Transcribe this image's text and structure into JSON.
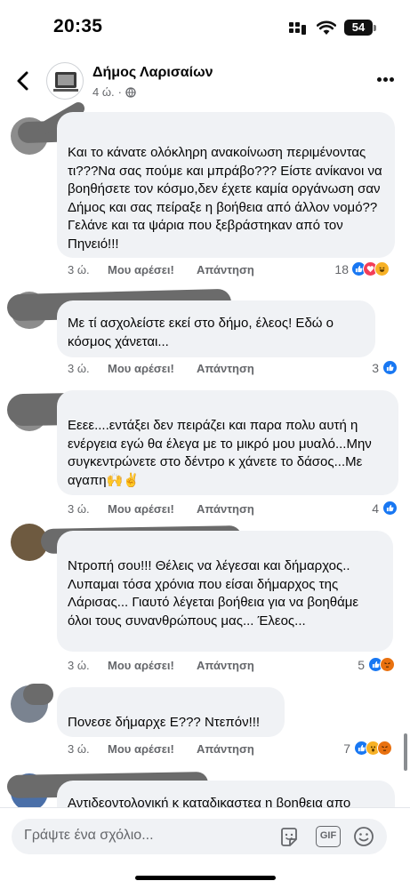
{
  "status_bar": {
    "time": "20:35",
    "battery": "54"
  },
  "header": {
    "page_name": "Δήμος Λαρισαίων",
    "time_ago": "4 ώ.",
    "audience_separator": "·"
  },
  "actions_labels": {
    "like": "Μου αρέσει!",
    "reply": "Απάντηση"
  },
  "comments": [
    {
      "text": "Και το κάνατε ολόκληρη ανακοίνωση περιμένοντας τι???Να σας πούμε και μπράβο??? Είστε ανίκανοι να βοηθήσετε τον κόσμο,δεν έχετε καμία οργάνωση σαν Δήμος και σας πείραξε η βοήθεια από άλλον νομό?? Γελάνε και τα ψάρια που ξεβράστηκαν από τον Πηνειό!!!",
      "time": "3 ώ.",
      "reactions_count": "18",
      "reactions": [
        "like",
        "love",
        "haha"
      ]
    },
    {
      "text": "Με τί ασχολείστε εκεί στο δήμο, έλεος! Εδώ ο κόσμος χάνεται...",
      "time": "3 ώ.",
      "reactions_count": "3",
      "reactions": [
        "like"
      ]
    },
    {
      "text": "Εεεε....εντάξει δεν πειράζει και παρα πολυ αυτή η ενέργεια εγώ θα έλεγα με το μικρό μου μυαλό...Μην συγκεντρώνετε στο δέντρο κ χάνετε το δάσος...Με αγαπη🙌✌️",
      "time": "3 ώ.",
      "reactions_count": "4",
      "reactions": [
        "like"
      ]
    },
    {
      "text": "Ντροπή σου!!! Θέλεις να λέγεσαι και δήμαρχος.. Λυπαμαι τόσα χρόνια που είσαι δήμαρχος της Λάρισας... Γιαυτό λέγεται βοήθεια για να βοηθάμε όλοι τους συνανθρώπους μας... Έλεος...",
      "time": "3 ώ.",
      "reactions_count": "5",
      "reactions": [
        "like",
        "angry"
      ]
    },
    {
      "text": "Πονεσε δήμαρχε Ε??? Ντεπόν!!!",
      "time": "3 ώ.",
      "reactions_count": "7",
      "reactions": [
        "like",
        "haha",
        "angry"
      ]
    },
    {
      "text": "Αντιδεοντολογική κ καταδικαστεα η βοηθεια απο"
    }
  ],
  "composer": {
    "placeholder": "Γράψτε ένα σχόλιο...",
    "gif_label": "GIF"
  },
  "icons": [
    "back-arrow-icon",
    "globe-icon",
    "more-icon",
    "like-reaction-icon",
    "love-reaction-icon",
    "haha-reaction-icon",
    "angry-reaction-icon",
    "sticker-icon",
    "gif-icon",
    "emoji-icon"
  ],
  "colors": {
    "like": "#1877f2",
    "love": "#f33e58",
    "haha": "#f7b125",
    "angry": "#e9710f",
    "bubble": "#f0f2f5",
    "secondary_text": "#65676b"
  }
}
